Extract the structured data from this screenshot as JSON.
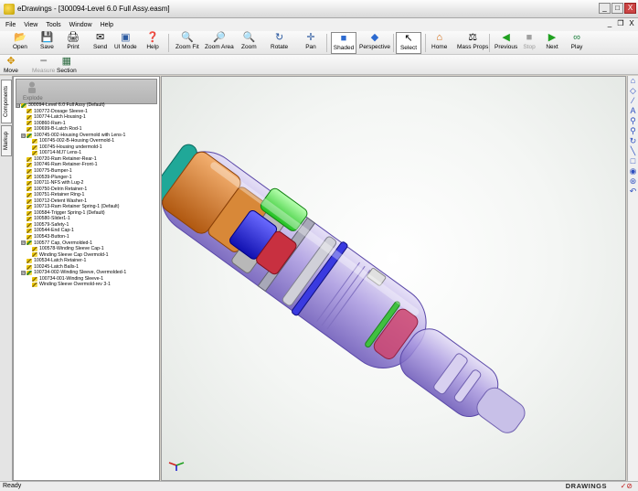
{
  "window": {
    "title": "eDrawings - [300094-Level 6.0 Full Assy.easm]",
    "min": "_",
    "max": "□",
    "close": "X"
  },
  "mdi_buttons": {
    "min": "_",
    "restore": "❐",
    "close": "X"
  },
  "menu": [
    "File",
    "View",
    "Tools",
    "Window",
    "Help"
  ],
  "toolbar": [
    {
      "label": "Open",
      "icon": "open-folder-icon"
    },
    {
      "label": "Save",
      "icon": "save-disk-icon"
    },
    {
      "label": "Print",
      "icon": "printer-icon"
    },
    {
      "label": "Send",
      "icon": "send-icon"
    },
    {
      "label": "UI Mode",
      "icon": "ui-mode-icon"
    },
    {
      "label": "Help",
      "icon": "help-icon"
    },
    {
      "label": "Zoom Fit",
      "icon": "zoom-fit-icon"
    },
    {
      "label": "Zoom Area",
      "icon": "zoom-area-icon"
    },
    {
      "label": "Zoom",
      "icon": "zoom-icon"
    },
    {
      "label": "Rotate",
      "icon": "rotate-icon"
    },
    {
      "label": "Pan",
      "icon": "pan-icon"
    },
    {
      "label": "Shaded",
      "icon": "shaded-icon",
      "selected": true
    },
    {
      "label": "Perspective",
      "icon": "perspective-icon"
    },
    {
      "label": "Select",
      "icon": "select-cursor-icon",
      "selected": true
    },
    {
      "label": "Home",
      "icon": "home-icon"
    },
    {
      "label": "Mass Props",
      "icon": "mass-props-icon"
    },
    {
      "label": "Previous",
      "icon": "previous-icon"
    },
    {
      "label": "Stop",
      "icon": "stop-icon",
      "disabled": true
    },
    {
      "label": "Next",
      "icon": "next-icon"
    },
    {
      "label": "Play",
      "icon": "play-icon"
    }
  ],
  "toolbar2": [
    {
      "label": "Move",
      "icon": "move-icon"
    },
    {
      "label": "Measure",
      "icon": "measure-icon",
      "disabled": true
    },
    {
      "label": "Section",
      "icon": "section-icon"
    }
  ],
  "side_tabs": [
    "Components",
    "Markup"
  ],
  "panel": {
    "explode_label": "Explode"
  },
  "tree": [
    {
      "level": 0,
      "expander": "⊟",
      "type": "asm",
      "label": "300094-Level 6.0 Full Assy (Default)"
    },
    {
      "level": 1,
      "type": "part",
      "label": "100772-Dosage Sleeve-1"
    },
    {
      "level": 1,
      "type": "part",
      "label": "100774-Latch Housing-1"
    },
    {
      "level": 1,
      "type": "part",
      "label": "100860-Ram-1"
    },
    {
      "level": 1,
      "type": "part",
      "label": "100699-B-Latch Rod-1"
    },
    {
      "level": 1,
      "expander": "⊟",
      "type": "asm",
      "label": "100745-002-Housing Overmold with Lens-1"
    },
    {
      "level": 2,
      "type": "part",
      "label": "100745-002-B-Housing Overmold-1"
    },
    {
      "level": 2,
      "type": "part",
      "label": "100745-Housing undermold-1"
    },
    {
      "level": 2,
      "type": "part",
      "label": "100714-MJ7 Lens-1"
    },
    {
      "level": 1,
      "type": "part",
      "label": "100720-Ram Retainer-Rear-1"
    },
    {
      "level": 1,
      "type": "part",
      "label": "100746-Ram Retainer-Front-1"
    },
    {
      "level": 1,
      "type": "part",
      "label": "100775-Bumper-1"
    },
    {
      "level": 1,
      "type": "part",
      "label": "100539-Plunger-1"
    },
    {
      "level": 1,
      "type": "part",
      "label": "100711-NFS with Lug-2"
    },
    {
      "level": 1,
      "type": "part",
      "label": "100750-Delrin Retainer-1"
    },
    {
      "level": 1,
      "type": "part",
      "label": "100751-Retainer Ring-1"
    },
    {
      "level": 1,
      "type": "part",
      "label": "100712-Detent Washer-1"
    },
    {
      "level": 1,
      "type": "part",
      "label": "100713-Ram Retainer Spring-1 (Default)"
    },
    {
      "level": 1,
      "type": "part",
      "label": "100584-Trigger Spring-1 (Default)"
    },
    {
      "level": 1,
      "type": "part",
      "label": "100580-Slider1-1"
    },
    {
      "level": 1,
      "type": "part",
      "label": "100579-Safety-1"
    },
    {
      "level": 1,
      "type": "part",
      "label": "100544-End Cap-1"
    },
    {
      "level": 1,
      "type": "part",
      "label": "100543-Button-1"
    },
    {
      "level": 1,
      "expander": "⊟",
      "type": "asm",
      "label": "100577 Cap, Overmolded-1"
    },
    {
      "level": 2,
      "type": "part",
      "label": "100578-Winding Sleeve Cap-1"
    },
    {
      "level": 2,
      "type": "part",
      "label": "Winding Sleeve Cap Overmold-1"
    },
    {
      "level": 1,
      "type": "part",
      "label": "100534-Latch Retainer-1"
    },
    {
      "level": 1,
      "type": "part",
      "label": "100245-Latch Balls-1"
    },
    {
      "level": 1,
      "expander": "⊟",
      "type": "asm",
      "label": "100734-002-Winding Sleeve, Overmolded-1"
    },
    {
      "level": 2,
      "type": "part",
      "label": "100734-001-Winding Sleeve-1"
    },
    {
      "level": 2,
      "type": "part",
      "label": "Winding Sleeve Overmold-rev 3-1"
    }
  ],
  "right_tools": [
    "⌂",
    "◇",
    "⁄",
    "A",
    "⚲",
    "⚲",
    "↻",
    "╲",
    "□",
    "◉",
    "⊛",
    "↶"
  ],
  "status": {
    "text": "Ready",
    "brand": "DRAWINGS",
    "brand_icons": "✓⊘"
  }
}
